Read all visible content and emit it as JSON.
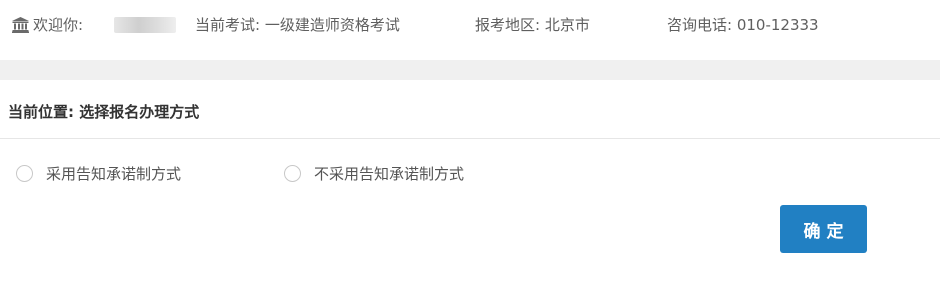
{
  "header": {
    "welcome_label": "欢迎你:",
    "exam_label": "当前考试: 一级建造师资格考试",
    "region_label": "报考地区: 北京市",
    "phone_label": "咨询电话: 010-12333",
    "icon": "bank-building-icon"
  },
  "breadcrumb": {
    "text": "当前位置: 选择报名办理方式"
  },
  "options": [
    {
      "label": "采用告知承诺制方式",
      "selected": false
    },
    {
      "label": "不采用告知承诺制方式",
      "selected": false
    }
  ],
  "actions": {
    "confirm_label": "确定"
  },
  "colors": {
    "primary": "#2180c3",
    "band": "#f0f0f0",
    "text": "#5f5f5f"
  }
}
